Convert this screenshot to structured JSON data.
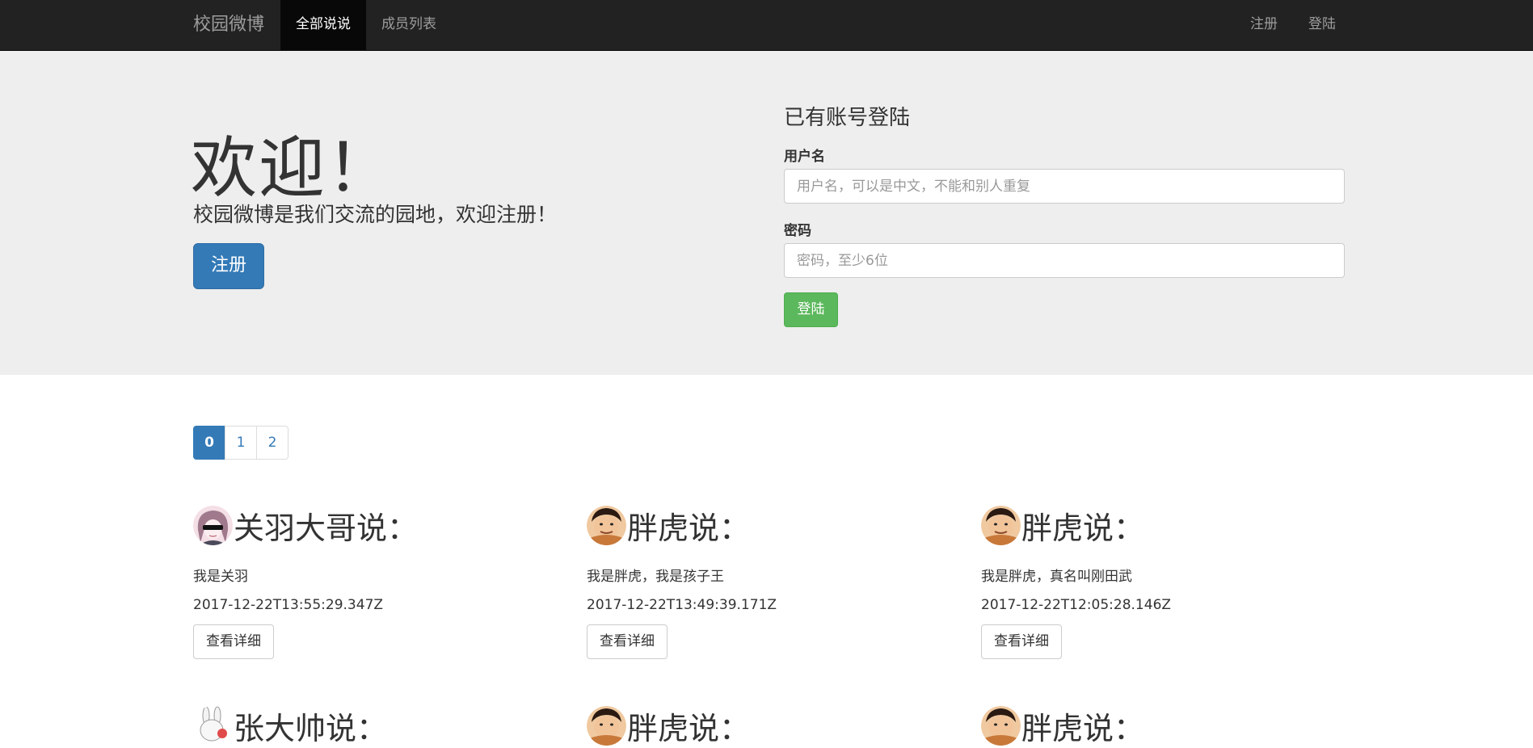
{
  "navbar": {
    "brand": "校园微博",
    "left_items": [
      {
        "label": "全部说说",
        "active": true
      },
      {
        "label": "成员列表",
        "active": false
      }
    ],
    "right_items": [
      {
        "label": "注册"
      },
      {
        "label": "登陆"
      }
    ]
  },
  "jumbotron": {
    "title": "欢迎！",
    "subtitle": "校园微博是我们交流的园地，欢迎注册！",
    "register_button": "注册"
  },
  "login": {
    "title": "已有账号登陆",
    "username_label": "用户名",
    "username_placeholder": "用户名，可以是中文，不能和别人重复",
    "password_label": "密码",
    "password_placeholder": "密码，至少6位",
    "submit_label": "登陆"
  },
  "pagination": {
    "pages": [
      "0",
      "1",
      "2"
    ],
    "active": "0"
  },
  "posts": [
    {
      "author": "关羽大哥说：",
      "content": "我是关羽",
      "time": "2017-12-22T13:55:29.347Z",
      "button": "查看详细",
      "avatar": "anime-girl-sunglasses"
    },
    {
      "author": "胖虎说：",
      "content": "我是胖虎，我是孩子王",
      "time": "2017-12-22T13:49:39.171Z",
      "button": "查看详细",
      "avatar": "gian"
    },
    {
      "author": "胖虎说：",
      "content": "我是胖虎，真名叫刚田武",
      "time": "2017-12-22T12:05:28.146Z",
      "button": "查看详细",
      "avatar": "gian"
    },
    {
      "author": "张大帅说：",
      "avatar": "rabbit"
    },
    {
      "author": "胖虎说：",
      "avatar": "gian"
    },
    {
      "author": "胖虎说：",
      "avatar": "gian"
    }
  ],
  "colors": {
    "navbar_bg": "#222222",
    "jumbotron_bg": "#eeeeee",
    "primary": "#337ab7",
    "success": "#5cb85c"
  }
}
